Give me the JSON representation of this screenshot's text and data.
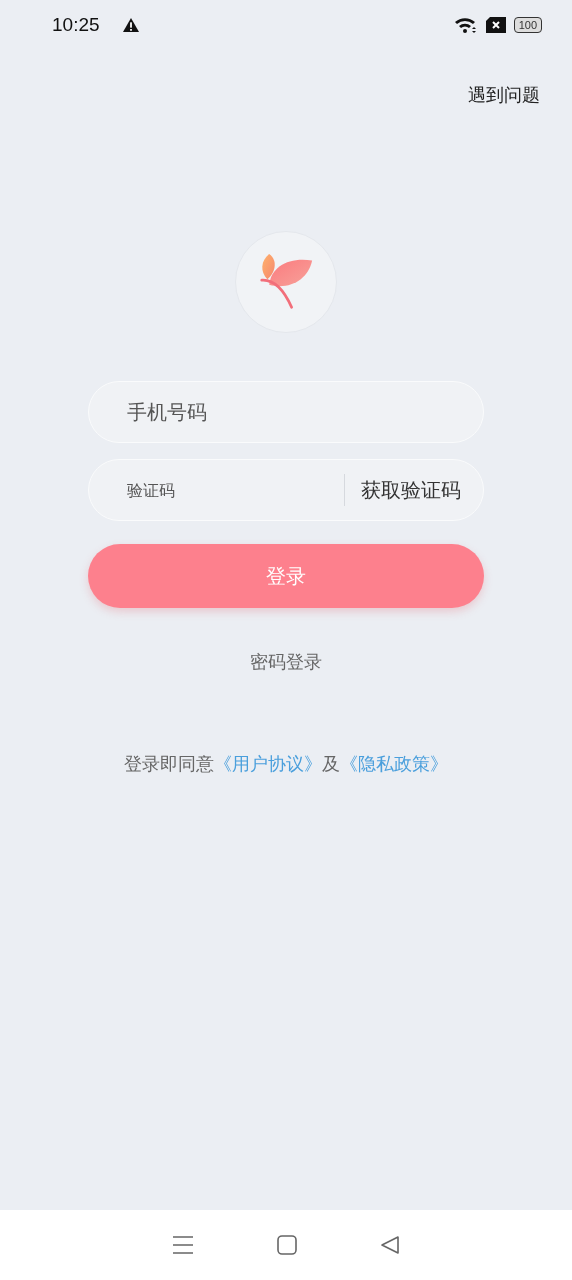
{
  "status_bar": {
    "time": "10:25",
    "battery": "100"
  },
  "help_link": "遇到问题",
  "phone_field": {
    "placeholder": "手机号码"
  },
  "code_field": {
    "placeholder": "验证码"
  },
  "get_code_button": "获取验证码",
  "login_button": "登录",
  "password_login_link": "密码登录",
  "agreement": {
    "prefix": "登录即同意",
    "terms_link": "《用户协议》",
    "joiner": "及",
    "privacy_link": "《隐私政策》"
  }
}
